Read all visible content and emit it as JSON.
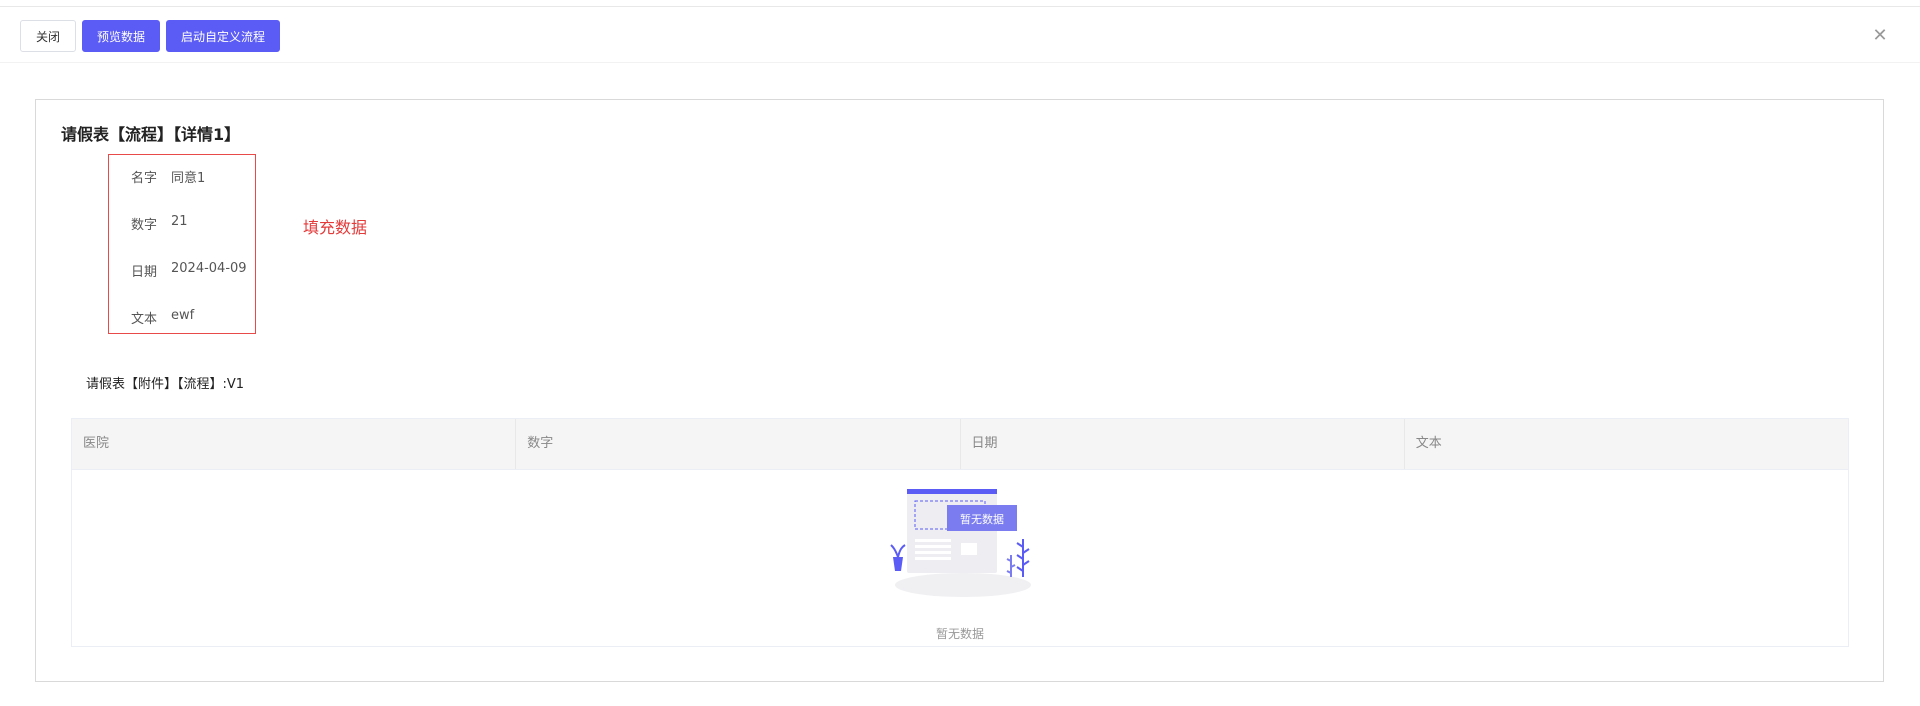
{
  "toolbar": {
    "close_label": "关闭",
    "preview_label": "预览数据",
    "start_flow_label": "启动自定义流程"
  },
  "form": {
    "title": "请假表【流程】【详情1】",
    "fields": [
      {
        "label": "名字",
        "value": "同意1"
      },
      {
        "label": "数字",
        "value": "21"
      },
      {
        "label": "日期",
        "value": "2024-04-09"
      },
      {
        "label": "文本",
        "value": "ewf"
      }
    ],
    "annotation": "填充数据"
  },
  "subtable": {
    "title": "请假表【附件】【流程】:V1",
    "columns": [
      "医院",
      "数字",
      "日期",
      "文本"
    ],
    "empty_illustration_label": "暂无数据",
    "empty_text": "暂无数据"
  },
  "colors": {
    "primary": "#5b5bf6",
    "annotation": "#e33a3a"
  }
}
